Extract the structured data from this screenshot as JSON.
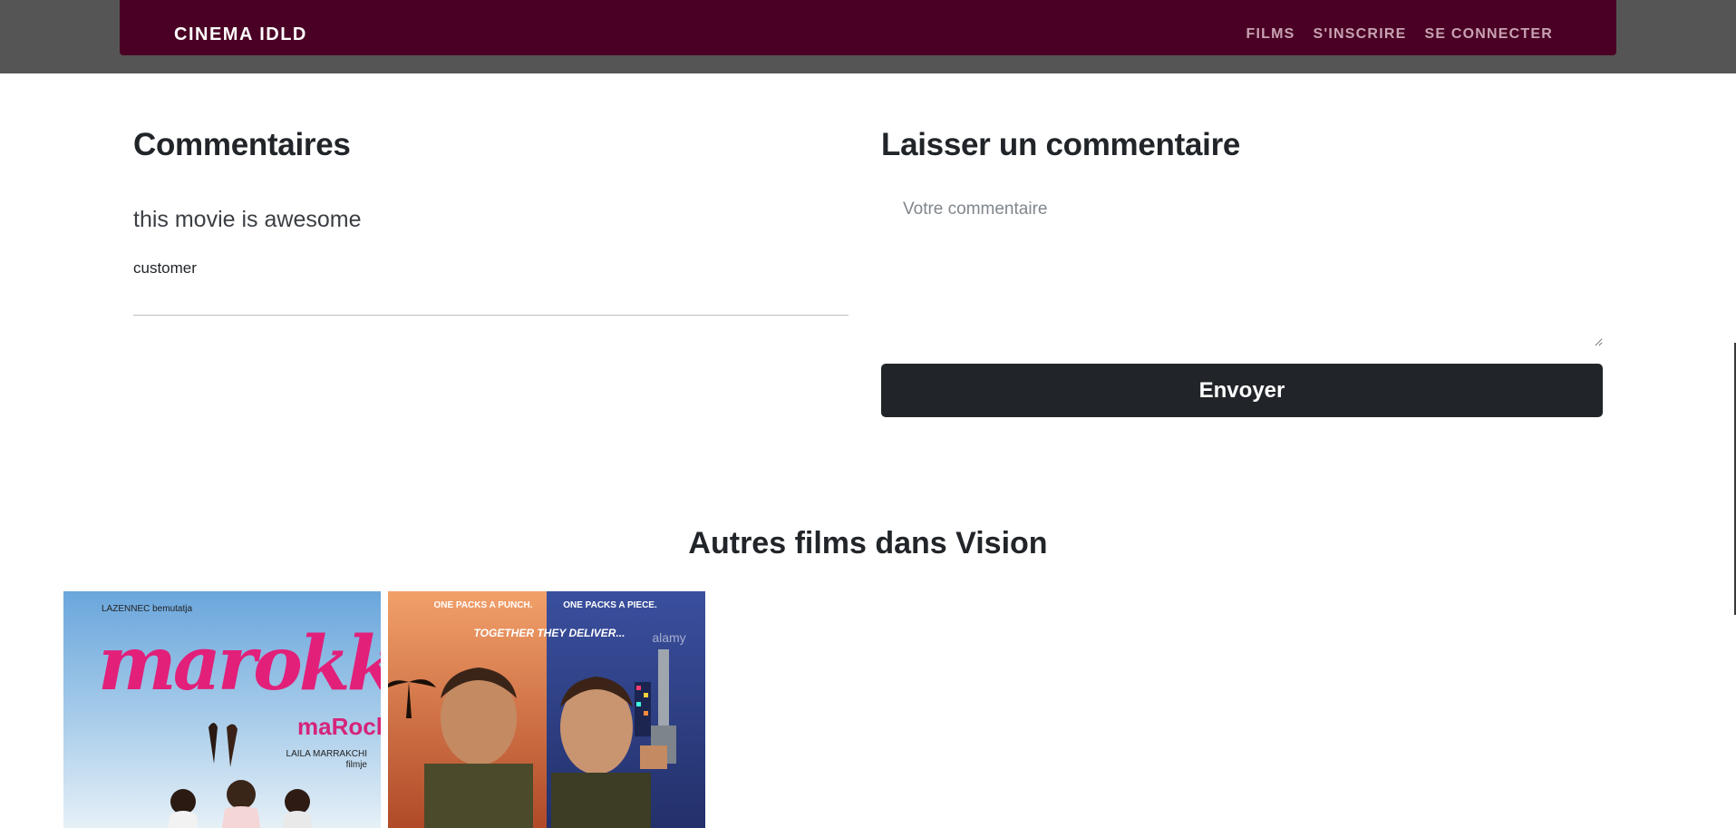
{
  "navbar": {
    "brand": "CINEMA IDLD",
    "links": [
      "FILMS",
      "S'INSCRIRE",
      "SE CONNECTER"
    ],
    "color": "#4a0024"
  },
  "comments": {
    "title": "Commentaires",
    "items": [
      {
        "text": "this movie is awesome",
        "author": "customer"
      }
    ]
  },
  "comment_form": {
    "title": "Laisser un commentaire",
    "placeholder": "Votre commentaire",
    "submit_label": "Envoyer"
  },
  "other_films": {
    "title": "Autres films dans Vision",
    "posters": [
      {
        "publisher": "LAZENNEC bemutatja",
        "title": "marokkó",
        "subtitle": "maRock",
        "director": "LAILA MARRAKCHI",
        "director_suffix": "filmje"
      },
      {
        "tagline_left": "ONE PACKS A PUNCH.",
        "tagline_right": "ONE PACKS A PIECE.",
        "tagline": "TOGETHER THEY DELIVER...",
        "watermark": "alamy"
      }
    ]
  }
}
